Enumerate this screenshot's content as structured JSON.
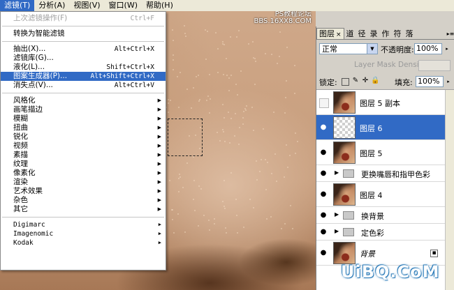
{
  "menubar": {
    "items": [
      "滤镜(T)",
      "分析(A)",
      "视图(V)",
      "窗口(W)",
      "帮助(H)"
    ]
  },
  "filter_menu": {
    "last_filter": {
      "label": "上次滤镜操作(F)",
      "shortcut": "Ctrl+F"
    },
    "smart_filter": "转换为智能滤镜",
    "items": [
      {
        "label": "抽出(X)...",
        "shortcut": "Alt+Ctrl+X"
      },
      {
        "label": "滤镜库(G)...",
        "shortcut": ""
      },
      {
        "label": "液化(L)...",
        "shortcut": "Shift+Ctrl+X"
      },
      {
        "label": "图案生成器(P)...",
        "shortcut": "Alt+Shift+Ctrl+X"
      },
      {
        "label": "消失点(V)...",
        "shortcut": "Alt+Ctrl+V"
      }
    ],
    "submenus": [
      "风格化",
      "画笔描边",
      "模糊",
      "扭曲",
      "锐化",
      "视频",
      "素描",
      "纹理",
      "像素化",
      "渲染",
      "艺术效果",
      "杂色",
      "其它"
    ],
    "plugins": [
      "Digimarc",
      "Imagenomic",
      "Kodak"
    ]
  },
  "layers_panel": {
    "tabs": [
      "图层",
      "道",
      "径",
      "录",
      "作",
      "符",
      "落"
    ],
    "blend_mode": "正常",
    "opacity_label": "不透明度:",
    "opacity_value": "100%",
    "density_label": "Layer Mask Density",
    "lock_label": "锁定:",
    "fill_label": "填充:",
    "fill_value": "100%",
    "layers": [
      {
        "name": "图层 5 副本",
        "type": "layer",
        "visible": false,
        "selected": false,
        "thumb": "face"
      },
      {
        "name": "图层 6",
        "type": "layer",
        "visible": true,
        "selected": true,
        "thumb": "trans"
      },
      {
        "name": "图层 5",
        "type": "layer",
        "visible": true,
        "selected": false,
        "thumb": "face"
      },
      {
        "name": "更换嘴唇和指甲色彩",
        "type": "group",
        "visible": true,
        "selected": false
      },
      {
        "name": "图层 4",
        "type": "layer",
        "visible": true,
        "selected": false,
        "thumb": "face"
      },
      {
        "name": "换背景",
        "type": "group",
        "visible": true,
        "selected": false
      },
      {
        "name": "定色彩",
        "type": "group",
        "visible": true,
        "selected": false
      },
      {
        "name": "背景",
        "type": "layer",
        "visible": true,
        "selected": false,
        "thumb": "face",
        "locked": true
      }
    ]
  },
  "watermarks": {
    "top": "PS教程论坛\nBBS.16XX8.COM",
    "logo": "UiBQ.CoM"
  },
  "colors": {
    "highlight": "#316ac5",
    "menubar_bg": "#ece9d8",
    "panel_bg": "#d4d0c8"
  }
}
